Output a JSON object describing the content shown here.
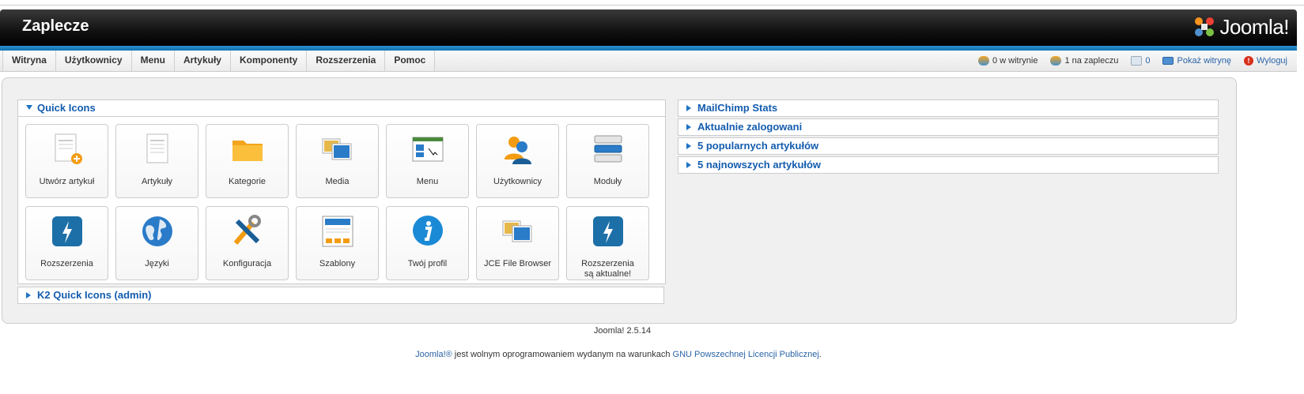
{
  "header": {
    "title": "Zaplecze",
    "logo_text": "Joomla!"
  },
  "menu": {
    "items": [
      "Witryna",
      "Użytkownicy",
      "Menu",
      "Artykuły",
      "Komponenty",
      "Rozszerzenia",
      "Pomoc"
    ]
  },
  "status": {
    "site_users": "0 w witrynie",
    "admin_users": "1 na zapleczu",
    "messages": "0",
    "view_site": "Pokaż witrynę",
    "logout": "Wyloguj"
  },
  "quick_icons": {
    "title": "Quick Icons",
    "row1": [
      "Utwórz artykuł",
      "Artykuły",
      "Kategorie",
      "Media",
      "Menu",
      "Użytkownicy",
      "Moduły"
    ],
    "row2": [
      "Rozszerzenia",
      "Języki",
      "Konfiguracja",
      "Szablony",
      "Twój profil",
      "JCE File Browser",
      "Rozszerzenia",
      "są aktualne!"
    ]
  },
  "k2_panel": {
    "title": "K2 Quick Icons (admin)"
  },
  "right_panels": [
    "MailChimp Stats",
    "Aktualnie zalogowani",
    "5 popularnych artykułów",
    "5 najnowszych artykułów"
  ],
  "footer": {
    "version": "Joomla! 2.5.14",
    "license_link1": "Joomla!®",
    "license_text": " jest wolnym oprogramowaniem wydanym na warunkach ",
    "license_link2": "GNU Powszechnej Licencji Publicznej",
    "license_end": "."
  },
  "colors": {
    "accent": "#135cae",
    "bluebar": "#1a7cc0",
    "header": "#111111"
  }
}
